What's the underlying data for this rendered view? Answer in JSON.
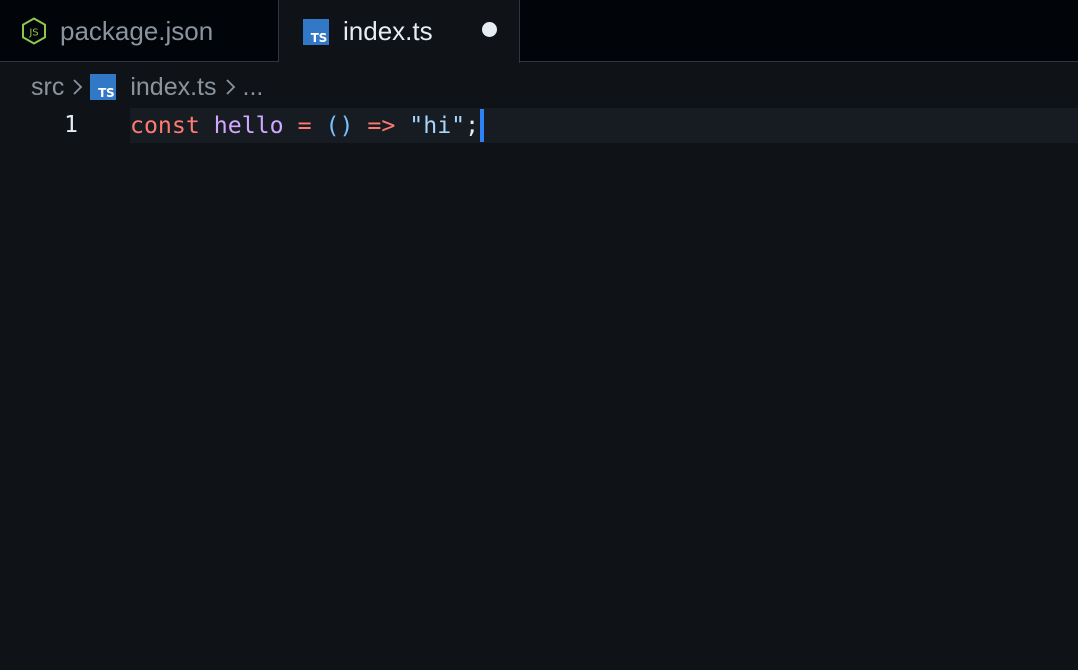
{
  "tabs": [
    {
      "label": "package.json",
      "icon": "nodejs-icon",
      "active": false
    },
    {
      "label": "index.ts",
      "icon": "typescript-icon",
      "active": true,
      "modified": true
    }
  ],
  "breadcrumb": {
    "folder": "src",
    "file": "index.ts",
    "more": "..."
  },
  "icons": {
    "ts_badge": "TS"
  },
  "editor": {
    "line_number": "1",
    "tokens": {
      "keyword": "const",
      "name": "hello",
      "assign": "=",
      "parens": "()",
      "arrow": "=>",
      "string": "\"hi\"",
      "semicolon": ";"
    }
  },
  "colors": {
    "background": "#0f1217",
    "tabbar": "#010409",
    "ts_blue": "#3178c6",
    "node_green": "#8cc84b",
    "cursor": "#2f81f7"
  }
}
